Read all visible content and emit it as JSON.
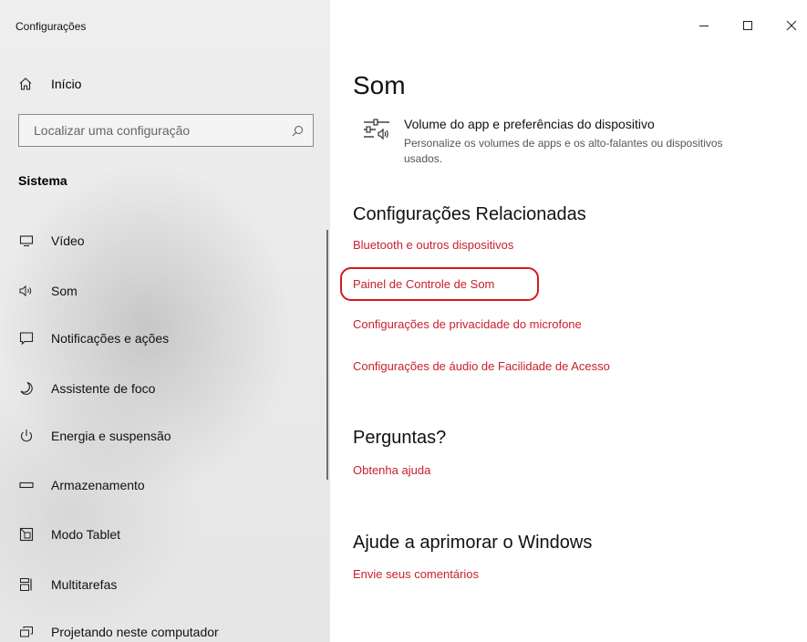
{
  "window": {
    "title": "Configurações",
    "minimize_glyph": "—",
    "maximize_glyph": "☐",
    "close_glyph": "✕"
  },
  "sidebar": {
    "home_label": "Início",
    "search_placeholder": "Localizar uma configuração",
    "section_label": "Sistema",
    "items": [
      {
        "label": "Vídeo",
        "icon": "monitor-icon"
      },
      {
        "label": "Som",
        "icon": "speaker-icon"
      },
      {
        "label": "Notificações e ações",
        "icon": "notification-icon"
      },
      {
        "label": "Assistente de foco",
        "icon": "moon-icon"
      },
      {
        "label": "Energia e suspensão",
        "icon": "power-icon"
      },
      {
        "label": "Armazenamento",
        "icon": "storage-icon"
      },
      {
        "label": "Modo Tablet",
        "icon": "tablet-icon"
      },
      {
        "label": "Multitarefas",
        "icon": "multitask-icon"
      },
      {
        "label": "Projetando neste computador",
        "icon": "project-icon"
      }
    ]
  },
  "main": {
    "title": "Som",
    "volume": {
      "icon": "volume-mixer-icon",
      "title": "Volume do app e preferências do dispositivo",
      "description": "Personalize os volumes de apps e os alto-falantes ou dispositivos usados."
    },
    "related": {
      "heading": "Configurações Relacionadas",
      "links": [
        "Bluetooth e outros dispositivos",
        "Painel de Controle de Som",
        "Configurações de privacidade do microfone",
        "Configurações de áudio de Facilidade de Acesso"
      ]
    },
    "questions": {
      "heading": "Perguntas?",
      "link": "Obtenha ajuda"
    },
    "improve": {
      "heading": "Ajude a aprimorar o Windows",
      "link": "Envie seus comentários"
    }
  },
  "colors": {
    "accent_link": "#c8202c",
    "highlight_circle": "#d7191d",
    "sidebar_bg": "#e9e9e9"
  }
}
